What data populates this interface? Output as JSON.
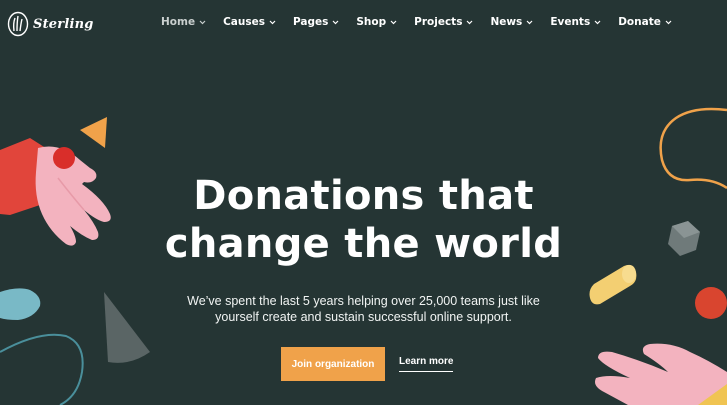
{
  "brand": {
    "name": "Sterling",
    "logo_icon": "hand-leaf-logo"
  },
  "nav": {
    "items": [
      {
        "label": "Home",
        "active": true
      },
      {
        "label": "Causes"
      },
      {
        "label": "Pages"
      },
      {
        "label": "Shop"
      },
      {
        "label": "Projects"
      },
      {
        "label": "News"
      },
      {
        "label": "Events"
      },
      {
        "label": "Donate"
      }
    ]
  },
  "hero": {
    "title_line1": "Donations that",
    "title_line2": "change the world",
    "subtitle_line1": "We’ve spent the last 5 years helping over 25,000 teams just like",
    "subtitle_line2": "yourself create and sustain successful online support.",
    "primary_button": "Join organization",
    "secondary_link": "Learn more"
  },
  "colors": {
    "background": "#253534",
    "accent": "#f0a24a",
    "text": "#ffffff",
    "nav_active": "#c9cfce"
  }
}
